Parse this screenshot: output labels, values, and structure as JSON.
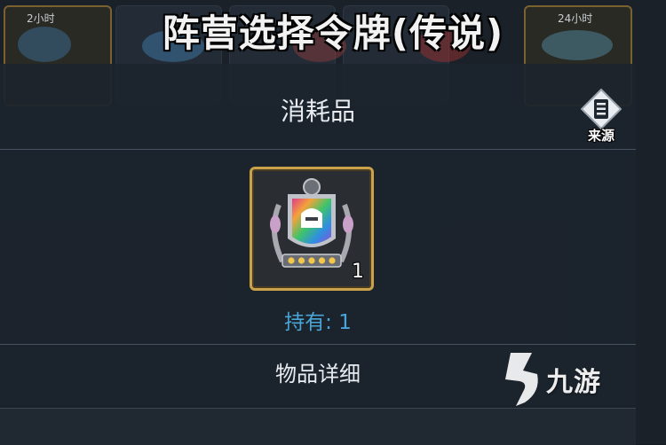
{
  "background": {
    "top_title": "阵营选择令牌(传说)",
    "timer_left": "2小时",
    "timer_right": "24小时"
  },
  "dialog": {
    "category_title": "消耗品",
    "source_button_label": "来源",
    "item": {
      "count": "1",
      "stars": 5,
      "frame_color": "#c9a24b"
    },
    "held_text": "持有: 1",
    "details_title": "物品详细"
  },
  "watermark": {
    "text": "九游"
  },
  "colors": {
    "accent_blue": "#4aa6d8",
    "gold": "#c9a24b",
    "panel": "#1c232c"
  }
}
